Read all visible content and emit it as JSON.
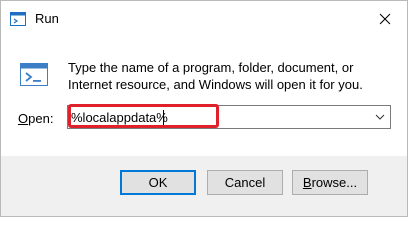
{
  "window": {
    "title": "Run",
    "icon": "run-app-icon",
    "close_icon": "close-icon"
  },
  "description": "Type the name of a program, folder, document, or Internet resource, and Windows will open it for you.",
  "open_field": {
    "label_prefix": "O",
    "label_rest": "pen:",
    "value": "%localappdata%",
    "dropdown_icon": "chevron-down-icon"
  },
  "highlight_color": "#e0202a",
  "buttons": {
    "ok": "OK",
    "cancel": "Cancel",
    "browse_prefix": "B",
    "browse_rest": "rowse..."
  },
  "colors": {
    "accent": "#0078d7",
    "footer_bg": "#f0f0f0"
  }
}
